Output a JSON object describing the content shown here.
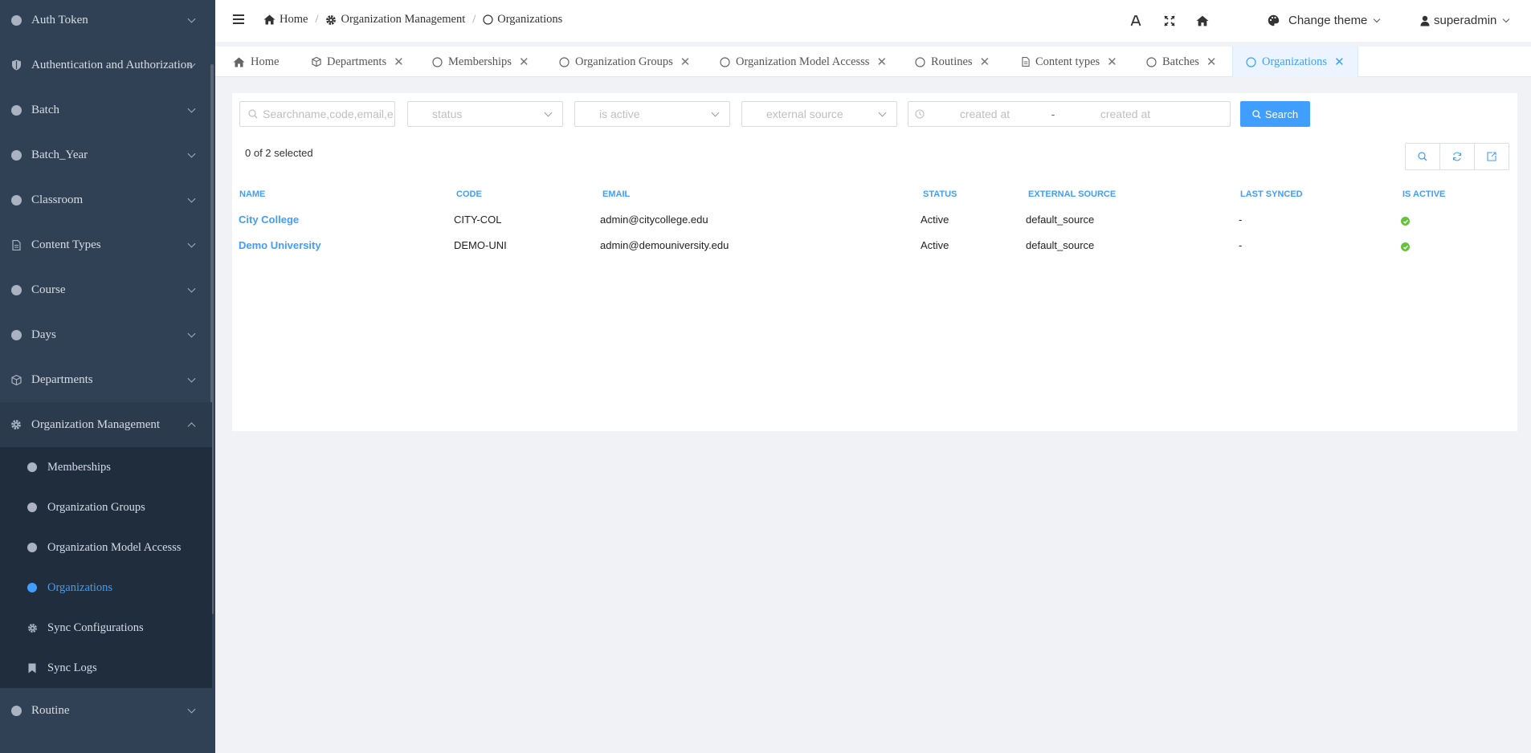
{
  "sidebar": {
    "items": [
      {
        "label": "Auth Token",
        "icon": "dot"
      },
      {
        "label": "Authentication and Authorization",
        "icon": "shield-icon"
      },
      {
        "label": "Batch",
        "icon": "dot"
      },
      {
        "label": "Batch_Year",
        "icon": "dot"
      },
      {
        "label": "Classroom",
        "icon": "dot"
      },
      {
        "label": "Content Types",
        "icon": "file-icon"
      },
      {
        "label": "Course",
        "icon": "dot"
      },
      {
        "label": "Days",
        "icon": "dot"
      },
      {
        "label": "Departments",
        "icon": "cube-icon"
      },
      {
        "label": "Organization Management",
        "icon": "gear-icon"
      },
      {
        "label": "Routine",
        "icon": "dot"
      }
    ],
    "submenu": [
      {
        "label": "Memberships",
        "icon": "dot"
      },
      {
        "label": "Organization Groups",
        "icon": "dot"
      },
      {
        "label": "Organization Model Accesss",
        "icon": "dot"
      },
      {
        "label": "Organizations",
        "icon": "dot",
        "active": true
      },
      {
        "label": "Sync Configurations",
        "icon": "gear-icon"
      },
      {
        "label": "Sync Logs",
        "icon": "bookmark-icon"
      }
    ]
  },
  "header": {
    "breadcrumb": [
      "Home",
      "Organization Management",
      "Organizations"
    ],
    "theme_label": "Change theme",
    "user_label": "superadmin"
  },
  "tabs": [
    {
      "label": "Home",
      "icon": "home-icon",
      "closable": false
    },
    {
      "label": "Departments",
      "icon": "cube-icon",
      "closable": true
    },
    {
      "label": "Memberships",
      "icon": "circle-icon",
      "closable": true
    },
    {
      "label": "Organization Groups",
      "icon": "circle-icon",
      "closable": true
    },
    {
      "label": "Organization Model Accesss",
      "icon": "circle-icon",
      "closable": true
    },
    {
      "label": "Routines",
      "icon": "circle-icon",
      "closable": true
    },
    {
      "label": "Content types",
      "icon": "file-icon",
      "closable": true
    },
    {
      "label": "Batches",
      "icon": "circle-icon",
      "closable": true
    },
    {
      "label": "Organizations",
      "icon": "circle-icon",
      "closable": true,
      "active": true
    }
  ],
  "filters": {
    "search_placeholder": "Searchname,code,email,e:",
    "status_placeholder": "status",
    "is_active_placeholder": "is active",
    "external_source_placeholder": "external source",
    "created_from_placeholder": "created at",
    "created_sep": "-",
    "created_to_placeholder": "created at",
    "search_button": "Search"
  },
  "selection": "0 of 2 selected",
  "table": {
    "columns": [
      "NAME",
      "CODE",
      "EMAIL",
      "STATUS",
      "EXTERNAL SOURCE",
      "LAST SYNCED",
      "IS ACTIVE"
    ],
    "rows": [
      {
        "name": "City College",
        "code": "CITY-COL",
        "email": "admin@citycollege.edu",
        "status": "Active",
        "external_source": "default_source",
        "last_synced": "-",
        "is_active": true
      },
      {
        "name": "Demo University",
        "code": "DEMO-UNI",
        "email": "admin@demouniversity.edu",
        "status": "Active",
        "external_source": "default_source",
        "last_synced": "-",
        "is_active": true
      }
    ]
  },
  "colors": {
    "accent": "#409eff",
    "sidebar": "#304156",
    "success": "#67c23a"
  }
}
